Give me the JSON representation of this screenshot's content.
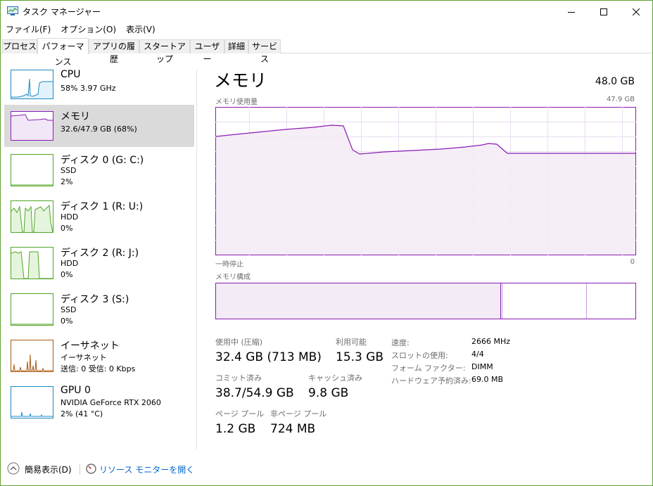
{
  "window": {
    "title": "タスク マネージャー",
    "controls": [
      "minimize",
      "maximize",
      "close"
    ]
  },
  "menu": [
    "ファイル(F)",
    "オプション(O)",
    "表示(V)"
  ],
  "tabs": [
    {
      "label": "プロセス",
      "active": false
    },
    {
      "label": "パフォーマンス",
      "active": true
    },
    {
      "label": "アプリの履歴",
      "active": false
    },
    {
      "label": "スタートアップ",
      "active": false
    },
    {
      "label": "ユーザー",
      "active": false
    },
    {
      "label": "詳細",
      "active": false
    },
    {
      "label": "サービス",
      "active": false
    }
  ],
  "resources": [
    {
      "name": "CPU",
      "line1": "58%  3.97 GHz",
      "line2": "",
      "color": "#1b8bc2",
      "selected": false
    },
    {
      "name": "メモリ",
      "line1": "32.6/47.9 GB (68%)",
      "line2": "",
      "color": "#8b1bb4",
      "selected": true
    },
    {
      "name": "ディスク 0 (G: C:)",
      "line1": "SSD",
      "line2": "2%",
      "color": "#4fa527",
      "selected": false
    },
    {
      "name": "ディスク 1 (R: U:)",
      "line1": "HDD",
      "line2": "0%",
      "color": "#4fa527",
      "selected": false
    },
    {
      "name": "ディスク 2 (R: J:)",
      "line1": "HDD",
      "line2": "0%",
      "color": "#4fa527",
      "selected": false
    },
    {
      "name": "ディスク 3 (S:)",
      "line1": "SSD",
      "line2": "0%",
      "color": "#4fa527",
      "selected": false
    },
    {
      "name": "イーサネット",
      "line1": "イーサネット",
      "line2": "送信: 0 受信: 0 Kbps",
      "color": "#a75b12",
      "selected": false
    },
    {
      "name": "GPU 0",
      "line1": "NVIDIA GeForce RTX 2060",
      "line2": "2% (41 °C)",
      "color": "#1b8bc2",
      "selected": false
    }
  ],
  "memory": {
    "title": "メモリ",
    "total": "48.0 GB",
    "usage_label": "メモリ使用量",
    "usage_max": "47.9 GB",
    "time_left": "一時停止",
    "time_right": "0",
    "composition_label": "メモリ構成",
    "composition": {
      "in_use_pct": 68,
      "modified_pct": 0.5,
      "standby_pct": 20.5,
      "free_pct": 11
    },
    "stats": {
      "in_use_label": "使用中 (圧縮)",
      "in_use_value": "32.4 GB (713 MB)",
      "available_label": "利用可能",
      "available_value": "15.3 GB",
      "committed_label": "コミット済み",
      "committed_value": "38.7/54.9 GB",
      "cached_label": "キャッシュ済み",
      "cached_value": "9.8 GB",
      "paged_label": "ページ プール",
      "paged_value": "1.2 GB",
      "nonpaged_label": "非ページ プール",
      "nonpaged_value": "724 MB"
    },
    "details": [
      {
        "label": "速度:",
        "value": "2666 MHz"
      },
      {
        "label": "スロットの使用:",
        "value": "4/4"
      },
      {
        "label": "フォーム ファクター:",
        "value": "DIMM"
      },
      {
        "label": "ハードウェア予約済み:",
        "value": "69.0 MB"
      }
    ]
  },
  "footer": {
    "fewer_details": "簡易表示(D)",
    "open_monitor": "リソース モニターを開く"
  }
}
